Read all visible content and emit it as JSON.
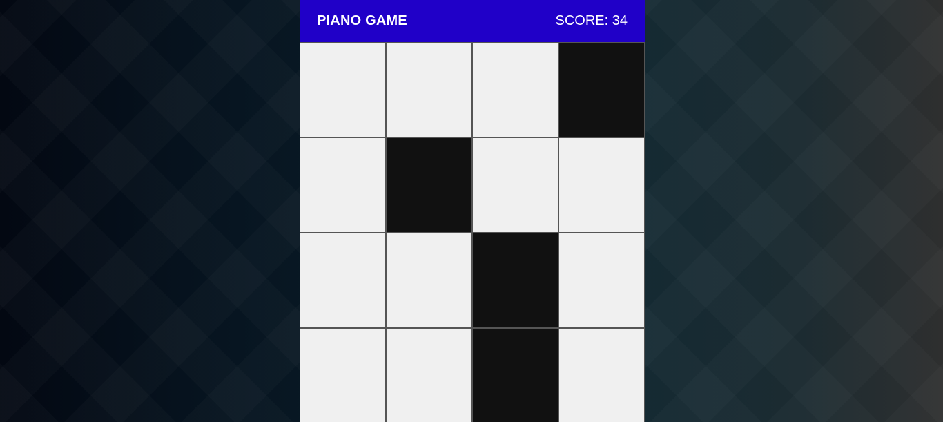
{
  "header": {
    "title": "PIANO GAME",
    "score_text": "SCORE: 34"
  },
  "board": {
    "columns": 4,
    "rows": [
      [
        false,
        false,
        false,
        true
      ],
      [
        false,
        true,
        false,
        false
      ],
      [
        false,
        false,
        true,
        false
      ],
      [
        false,
        false,
        true,
        false
      ]
    ]
  },
  "colors": {
    "header_bg": "#2000c8",
    "white_tile": "#f0f0f0",
    "black_tile": "#111111",
    "grid_line": "#555555"
  }
}
